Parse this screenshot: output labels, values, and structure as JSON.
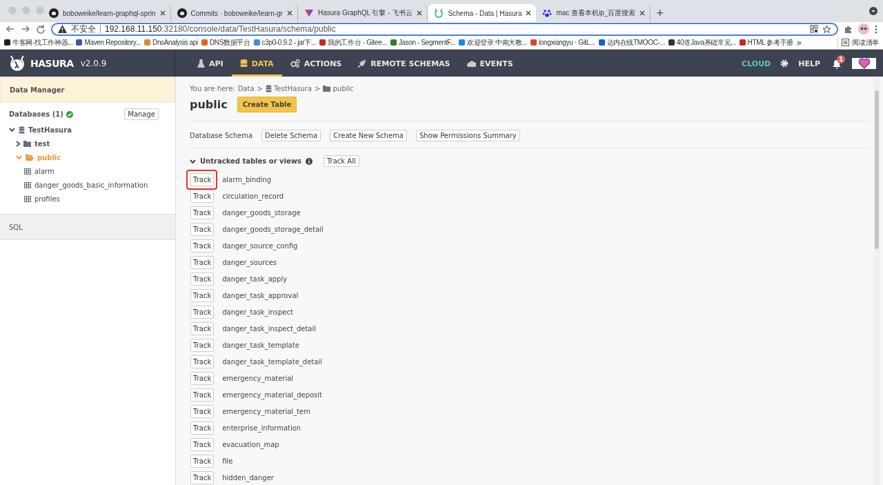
{
  "browser": {
    "tabs": [
      {
        "title": "boboweike/learn-graphql-sprin",
        "kind": "github",
        "selected": false
      },
      {
        "title": "Commits · boboweike/learn-gr",
        "kind": "github",
        "selected": false
      },
      {
        "title": "Hasura GraphQL 引擎 - 飞书云",
        "kind": "feishu",
        "selected": false
      },
      {
        "title": "Schema - Data | Hasura",
        "kind": "hasura",
        "selected": true
      },
      {
        "title": "mac 查看本机ip_百度搜索",
        "kind": "baidu",
        "selected": false
      }
    ],
    "new_tab": "+",
    "address": {
      "security": "不安全",
      "host": "192.168.11.150",
      "path": ":32180/console/data/TestHasura/schema/public"
    },
    "bookmarks": [
      {
        "label": "牛客网-找工作神器..."
      },
      {
        "label": "Maven Repository..."
      },
      {
        "label": "DnsAnalysis api"
      },
      {
        "label": "DNS数据平台"
      },
      {
        "label": "c3p0-0.9.2 - jar下..."
      },
      {
        "label": "我的工作台 - Gitee..."
      },
      {
        "label": "Jason - SegmentF..."
      },
      {
        "label": "欢迎登录 中南大教..."
      },
      {
        "label": "longxiangyu · GitL..."
      },
      {
        "label": "达内在线TMOOC-..."
      },
      {
        "label": "40道Java基础常见..."
      },
      {
        "label": "HTML 参考手册"
      }
    ],
    "more": "»",
    "reading_list": "阅读清单"
  },
  "header": {
    "brand": "HASURA",
    "version": "v2.0.9",
    "nav": [
      {
        "label": "API",
        "kind": "flask",
        "selected": false
      },
      {
        "label": "DATA",
        "kind": "database",
        "selected": true
      },
      {
        "label": "ACTIONS",
        "kind": "gears",
        "selected": false
      },
      {
        "label": "REMOTE SCHEMAS",
        "kind": "plug",
        "selected": false
      },
      {
        "label": "EVENTS",
        "kind": "cloud",
        "selected": false
      }
    ],
    "cloud": "CLOUD",
    "help": "HELP",
    "notifications": "1"
  },
  "sidebar": {
    "title": "Data Manager",
    "databases": "Databases (1)",
    "manage": "Manage",
    "tree": [
      {
        "label": "TestHasura",
        "kind": "database",
        "expanded": true,
        "selected": false,
        "children": [
          {
            "label": "test",
            "kind": "schema",
            "expanded": false,
            "selected": false
          },
          {
            "label": "public",
            "kind": "schema",
            "expanded": true,
            "selected": true,
            "children": [
              {
                "label": "alarm",
                "kind": "table",
                "selected": false
              },
              {
                "label": "danger_goods_basic_information",
                "kind": "table",
                "selected": false
              },
              {
                "label": "profiles",
                "kind": "table",
                "selected": false
              }
            ]
          }
        ]
      }
    ],
    "sql": "SQL"
  },
  "main": {
    "breadcrumb": {
      "prefix": "You are here:",
      "items": [
        {
          "label": "Data",
          "kind": "text"
        },
        {
          "label": "TestHasura",
          "kind": "database"
        },
        {
          "label": "public",
          "kind": "schema"
        }
      ],
      "separator": ">"
    },
    "title": "public",
    "create_table": "Create Table",
    "schema_label": "Database Schema",
    "schema_buttons": [
      "Delete Schema",
      "Create New Schema",
      "Show Permissions Summary"
    ],
    "untracked": {
      "label": "Untracked tables or views",
      "expanded": true,
      "track_all": "Track All",
      "rows": [
        {
          "button": "Track",
          "name": "alarm_binding",
          "highlighted": true
        },
        {
          "button": "Track",
          "name": "circulation_record",
          "highlighted": false
        },
        {
          "button": "Track",
          "name": "danger_goods_storage",
          "highlighted": false
        },
        {
          "button": "Track",
          "name": "danger_goods_storage_detail",
          "highlighted": false
        },
        {
          "button": "Track",
          "name": "danger_source_config",
          "highlighted": false
        },
        {
          "button": "Track",
          "name": "danger_sources",
          "highlighted": false
        },
        {
          "button": "Track",
          "name": "danger_task_apply",
          "highlighted": false
        },
        {
          "button": "Track",
          "name": "danger_task_approval",
          "highlighted": false
        },
        {
          "button": "Track",
          "name": "danger_task_inspect",
          "highlighted": false
        },
        {
          "button": "Track",
          "name": "danger_task_inspect_detail",
          "highlighted": false
        },
        {
          "button": "Track",
          "name": "danger_task_template",
          "highlighted": false
        },
        {
          "button": "Track",
          "name": "danger_task_template_detail",
          "highlighted": false
        },
        {
          "button": "Track",
          "name": "emergency_material",
          "highlighted": false
        },
        {
          "button": "Track",
          "name": "emergency_material_deposit",
          "highlighted": false
        },
        {
          "button": "Track",
          "name": "emergency_material_tem",
          "highlighted": false
        },
        {
          "button": "Track",
          "name": "enterprise_information",
          "highlighted": false
        },
        {
          "button": "Track",
          "name": "evacuation_map",
          "highlighted": false
        },
        {
          "button": "Track",
          "name": "file",
          "highlighted": false
        },
        {
          "button": "Track",
          "name": "hidden_danger",
          "highlighted": false
        }
      ]
    }
  }
}
